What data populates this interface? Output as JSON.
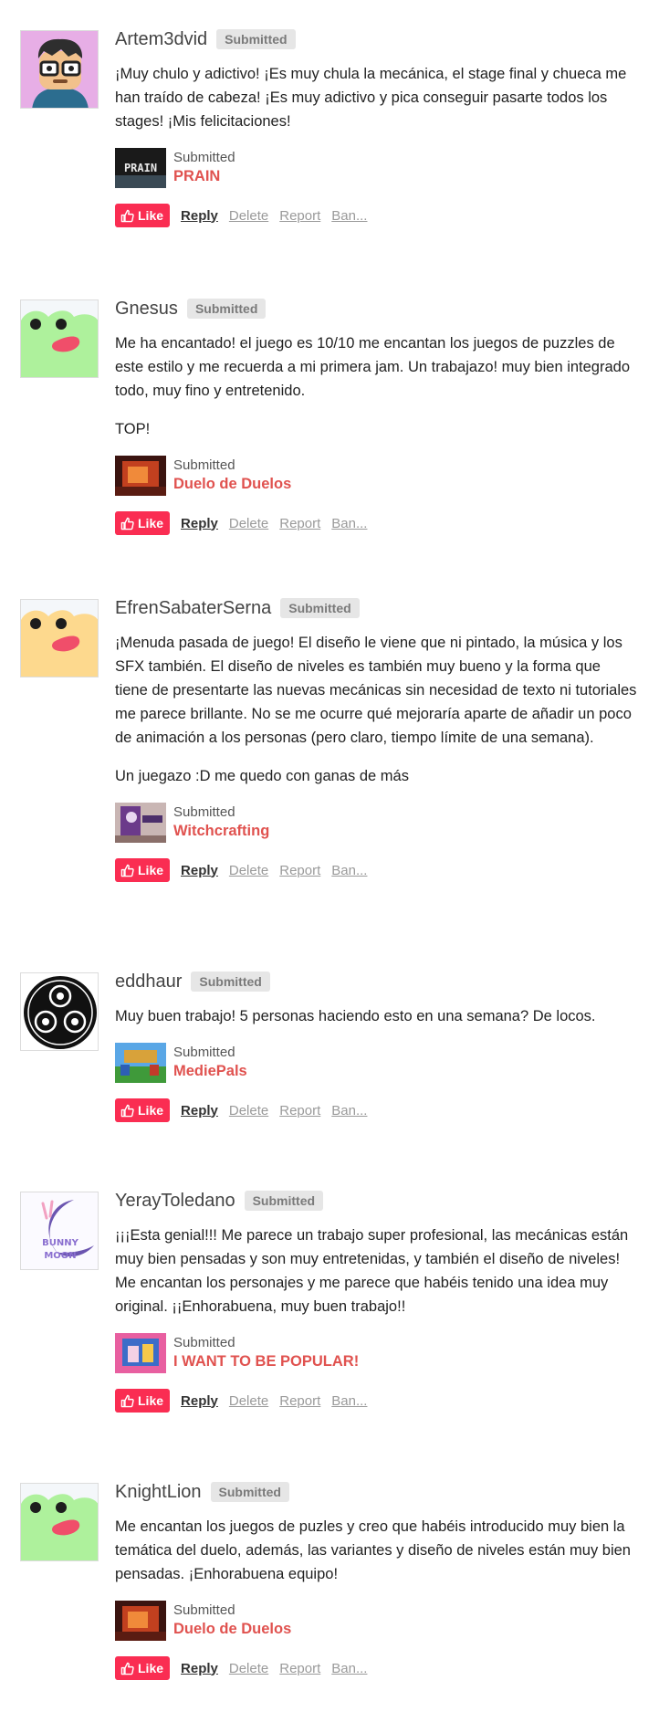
{
  "labels": {
    "badge": "Submitted",
    "submitted": "Submitted",
    "like": "Like",
    "reply": "Reply",
    "delete": "Delete",
    "report": "Report",
    "ban": "Ban..."
  },
  "colors": {
    "like_bg": "#fa2d52",
    "game_title": "#e0524f",
    "badge_bg": "#e6e6e6"
  },
  "comments": [
    {
      "author": "Artem3dvid",
      "avatar": "cartoon-character-avatar",
      "paragraphs": [
        "¡Muy chulo y adictivo! ¡Es muy chula la mecánica, el stage final y chueca me han traído de cabeza! ¡Es muy adictivo y pica conseguir pasarte todos los stages! ¡Mis felicitaciones!"
      ],
      "game": "PRAIN",
      "thumb_text": "PRAIN"
    },
    {
      "author": "Gnesus",
      "avatar": "green-frog-avatar",
      "paragraphs": [
        "Me ha encantado! el juego es 10/10 me encantan los juegos de puzzles de este estilo y me recuerda a mi primera jam. Un trabajazo! muy bien integrado todo, muy fino y entretenido.",
        "TOP!"
      ],
      "game": "Duelo de Duelos"
    },
    {
      "author": "EfrenSabaterSerna",
      "avatar": "yellow-frog-avatar",
      "paragraphs": [
        "¡Menuda pasada de juego! El diseño le viene que ni pintado, la música y los SFX también. El diseño de niveles es también muy bueno y la forma que tiene de presentarte las nuevas mecánicas sin necesidad de texto ni tutoriales me parece brillante. No se me ocurre qué mejoraría aparte de añadir un poco de animación a los personas (pero claro, tiempo límite de una semana).",
        "Un juegazo :D me quedo con ganas de más"
      ],
      "game": "Witchcrafting"
    },
    {
      "author": "eddhaur",
      "avatar": "triskelion-avatar",
      "paragraphs": [
        "Muy buen trabajo! 5 personas haciendo esto en una semana? De locos."
      ],
      "game": "MediePals"
    },
    {
      "author": "YerayToledano",
      "avatar": "bunny-moon-avatar",
      "paragraphs": [
        "¡¡¡Esta genial!!! Me parece un trabajo super profesional, las mecánicas están muy bien pensadas y son muy entretenidas, y también el diseño de niveles! Me encantan los personajes y me parece que habéis tenido una idea muy original. ¡¡Enhorabuena, muy buen trabajo!!"
      ],
      "game": "I WANT TO BE POPULAR!",
      "avatar_text": [
        "BUNNY",
        "MOON"
      ]
    },
    {
      "author": "KnightLion",
      "avatar": "green-frog-avatar",
      "paragraphs": [
        "Me encantan los juegos de puzles y creo que habéis introducido muy bien la temática del duelo, además, las variantes y diseño de niveles están muy bien pensadas. ¡Enhorabuena equipo!"
      ],
      "game": "Duelo de Duelos"
    }
  ]
}
